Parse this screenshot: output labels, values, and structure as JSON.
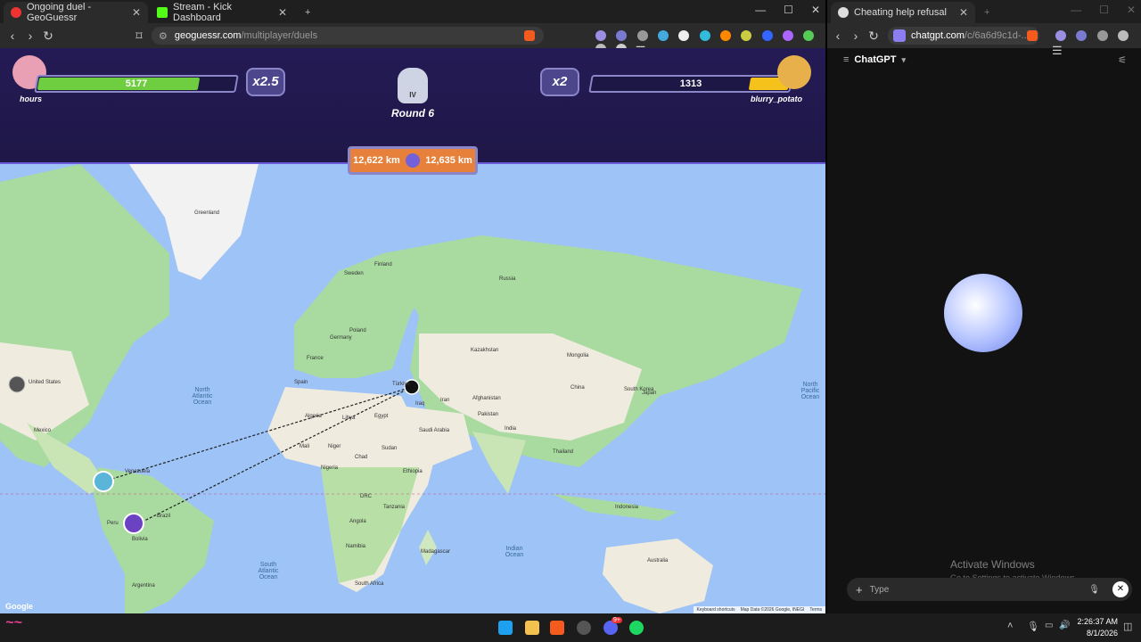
{
  "left_browser": {
    "tabs": [
      {
        "title": "Ongoing duel - GeoGuessr"
      },
      {
        "title": "Stream - Kick Dashboard"
      }
    ],
    "url_host": "geoguessr.com",
    "url_path": "/multiplayer/duels"
  },
  "game": {
    "round_label": "Round 6",
    "round_numeral": "IV",
    "player_left": {
      "name": "hours",
      "score": "5177",
      "health_fraction": 0.82,
      "multiplier": "x2.5"
    },
    "player_right": {
      "name": "blurry_potato",
      "score": "1313",
      "health_fraction": 0.2,
      "multiplier": "x2"
    },
    "distance_left": "12,622 km",
    "distance_right": "12,635 km",
    "map_labels": {
      "greenland": "Greenland",
      "sweden": "Sweden",
      "finland": "Finland",
      "poland": "Poland",
      "germany": "Germany",
      "france": "France",
      "spain": "Spain",
      "turkiye": "Türkiye",
      "iraq": "Iraq",
      "iran": "Iran",
      "kazakhstan": "Kazakhstan",
      "mongolia": "Mongolia",
      "china": "China",
      "south_korea": "South Korea",
      "japan": "Japan",
      "afghanistan": "Afghanistan",
      "pakistan": "Pakistan",
      "india": "India",
      "saudi_arabia": "Saudi Arabia",
      "egypt": "Egypt",
      "algeria": "Algeria",
      "libya": "Libya",
      "mali": "Mali",
      "niger": "Niger",
      "chad": "Chad",
      "sudan": "Sudan",
      "nigeria": "Nigeria",
      "ethiopia": "Ethiopia",
      "drc": "DRC",
      "tanzania": "Tanzania",
      "angola": "Angola",
      "namibia": "Namibia",
      "south_africa": "South Africa",
      "madagascar": "Madagascar",
      "united_states": "United States",
      "mexico": "Mexico",
      "venezuela": "Venezuela",
      "peru": "Peru",
      "brazil": "Brazil",
      "bolivia": "Bolivia",
      "argentina": "Argentina",
      "australia": "Australia",
      "indonesia": "Indonesia",
      "thailand": "Thailand",
      "north_atlantic": "North Atlantic Ocean",
      "north_pacific": "North Pacific Ocean",
      "south_atlantic": "South Atlantic Ocean",
      "indian_ocean": "Indian Ocean",
      "russia": "Russia"
    },
    "map_footer": {
      "google": "Google",
      "keyboard": "Keyboard shortcuts",
      "mapdata": "Map Data ©2026 Google, INEGI",
      "terms": "Terms"
    }
  },
  "right_browser": {
    "tab_title": "Cheating help refusal",
    "url_host": "chatgpt.com",
    "url_path": "/c/6a6d9c1d-...",
    "app_title": "ChatGPT",
    "input_placeholder": "Type",
    "watermark_title": "Activate Windows",
    "watermark_sub": "Go to Settings to activate Windows."
  },
  "taskbar": {
    "time": "2:26:37 AM",
    "date": "8/1/2026",
    "badge": "9+"
  }
}
